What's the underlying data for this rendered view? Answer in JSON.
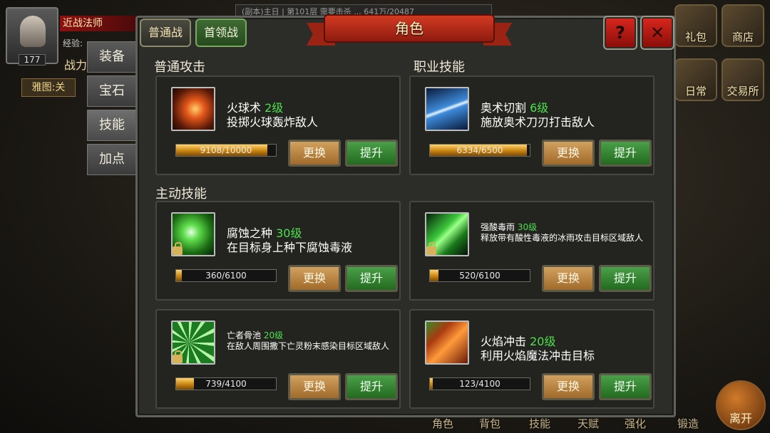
{
  "hud": {
    "name": "近战法师",
    "level": "177",
    "exp_label": "经验:",
    "power_label": "战力",
    "map_button": "雅图:关",
    "top_notice": "(副本)主日 | 第101层 需要击杀 ... 641万/20487",
    "right_icons": [
      "礼包",
      "商店",
      "日常",
      "交易所"
    ],
    "bottom_labels": [
      "角色",
      "背包",
      "技能",
      "天赋",
      "强化",
      "锻造"
    ],
    "leave": "离开"
  },
  "side_tabs": [
    "装备",
    "宝石",
    "技能",
    "加点"
  ],
  "active_side_tab": "技能",
  "mode_tabs": {
    "normal": "普通战",
    "boss": "首领战"
  },
  "title": "角色",
  "help_glyph": "?",
  "close_glyph": "✕",
  "sections": {
    "normal_attack": "普通攻击",
    "class_skill": "职业技能",
    "active_skill": "主动技能"
  },
  "buttons": {
    "swap": "更换",
    "upgrade": "提升"
  },
  "skills": [
    {
      "icon": "fireball-icon",
      "name": "火球术",
      "level": "2级",
      "desc": "投掷火球轰炸敌人",
      "exp": "9108/10000",
      "progress": 0.9108,
      "locked": false
    },
    {
      "icon": "arcane-slash-icon",
      "name": "奥术切割",
      "level": "6级",
      "desc": "施放奥术刀刃打击敌人",
      "exp": "6334/6500",
      "progress": 0.9745,
      "locked": false
    },
    {
      "icon": "corrosion-seed-icon",
      "name": "腐蚀之种",
      "level": "30级",
      "desc": "在目标身上种下腐蚀毒液",
      "exp": "360/6100",
      "progress": 0.059,
      "locked": true
    },
    {
      "icon": "acid-rain-icon",
      "name": "强酸毒雨",
      "level": "30级",
      "desc": "释放带有酸性毒液的冰雨攻击目标区域敌人",
      "exp": "520/6100",
      "progress": 0.085,
      "locked": true
    },
    {
      "icon": "bone-pool-icon",
      "name": "亡者骨池",
      "level": "20级",
      "desc": "在敌人周围撒下亡灵粉末感染目标区域敌人",
      "exp": "739/4100",
      "progress": 0.18,
      "locked": true
    },
    {
      "icon": "flame-strike-icon",
      "name": "火焰冲击",
      "level": "20级",
      "desc": "利用火焰魔法冲击目标",
      "exp": "123/4100",
      "progress": 0.03,
      "locked": false
    }
  ]
}
